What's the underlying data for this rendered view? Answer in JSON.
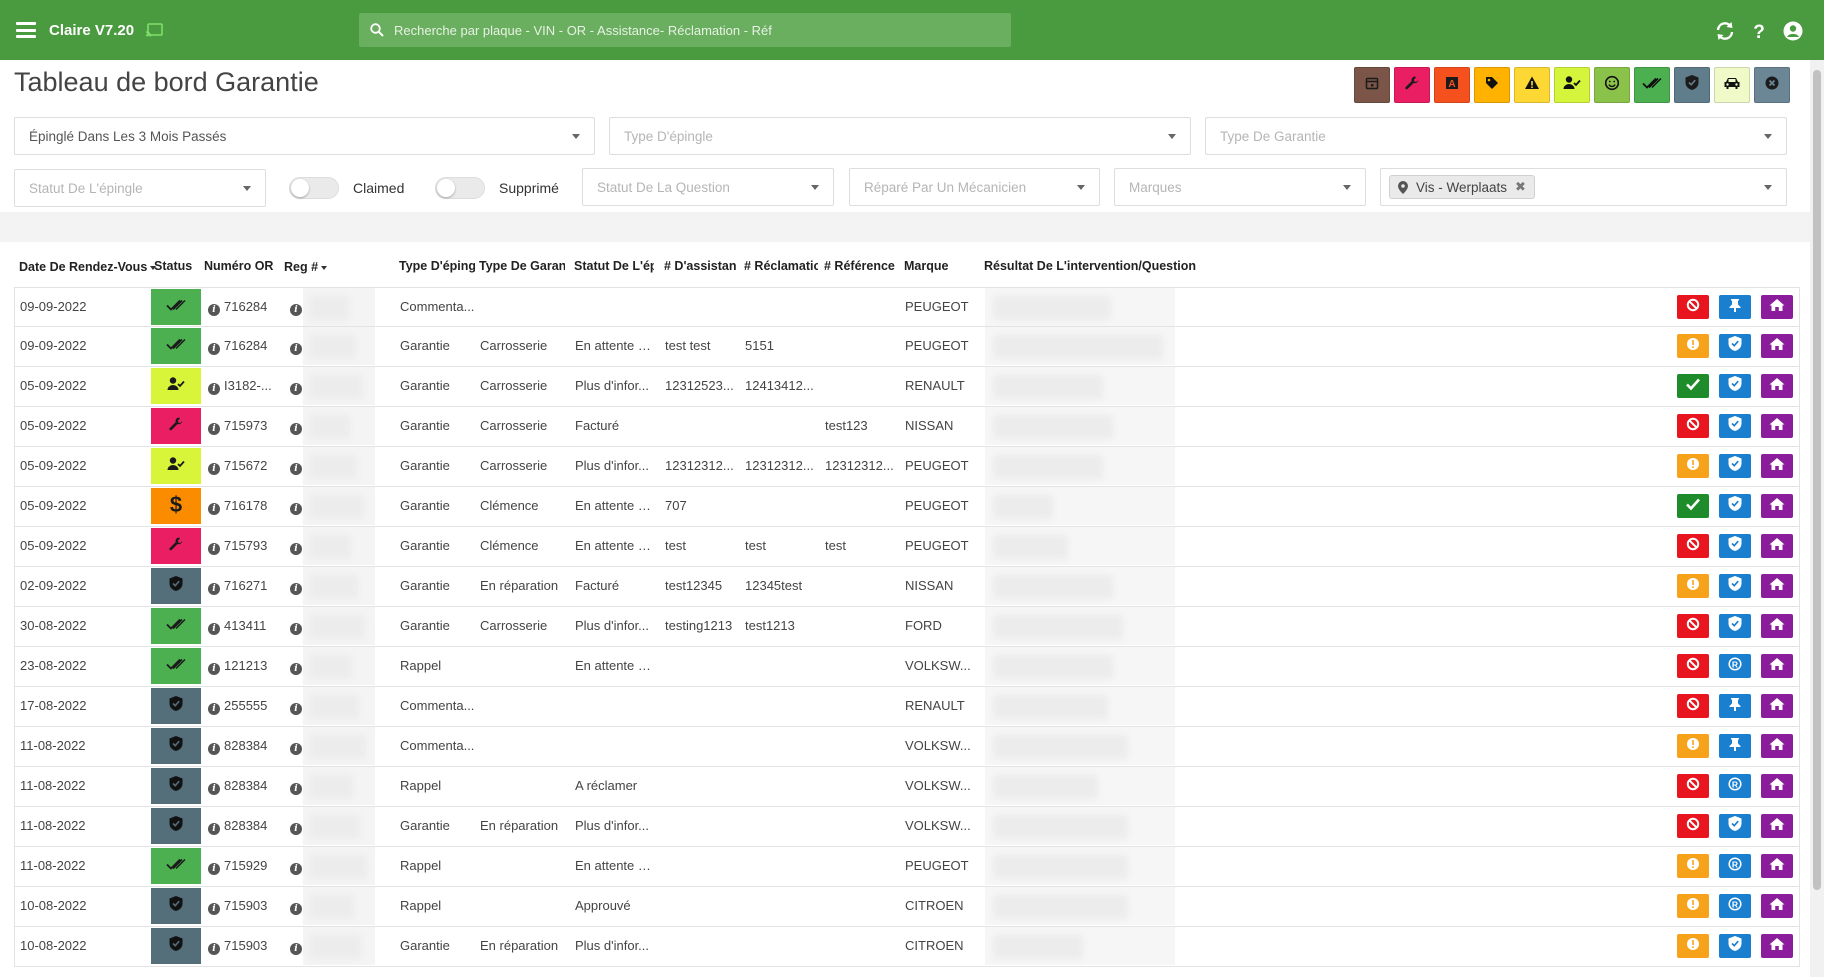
{
  "app": {
    "title": "Claire V7.20",
    "search_placeholder": "Recherche par plaque - VIN - OR - Assistance- Réclamation - Réf"
  },
  "page": {
    "title": "Tableau de bord Garantie"
  },
  "color_filters": [
    {
      "name": "calendar-icon",
      "color": "#7a5548"
    },
    {
      "name": "wrench-icon",
      "color": "#e91e63"
    },
    {
      "name": "font-icon",
      "color": "#f4511e"
    },
    {
      "name": "tag-icon",
      "color": "#ffb300"
    },
    {
      "name": "warning-icon",
      "color": "#fdd835"
    },
    {
      "name": "user-check-icon",
      "color": "#d4f53c"
    },
    {
      "name": "smile-icon",
      "color": "#8bc34a"
    },
    {
      "name": "double-check-icon",
      "color": "#4caf50"
    },
    {
      "name": "shield-icon",
      "color": "#607d8b"
    },
    {
      "name": "car-icon",
      "color": "#f0f9c8"
    },
    {
      "name": "close-circle-icon",
      "color": "#6b8795"
    }
  ],
  "filters": {
    "pinned_period": "Épinglé Dans Les 3 Mois Passés",
    "pin_type": "Type D'épingle",
    "warranty_type": "Type De Garantie",
    "pin_status": "Statut De L'épingle",
    "claimed_label": "Claimed",
    "deleted_label": "Supprimé",
    "question_status": "Statut De La Question",
    "repaired_by": "Réparé Par Un Mécanicien",
    "brands": "Marques",
    "location_chip": "Vis - Werplaats"
  },
  "table": {
    "headers": {
      "date": "Date De Rendez-Vous",
      "status": "Status",
      "or_number": "Numéro OR",
      "reg": "Reg #",
      "pin_type": "Type D'épingle",
      "warranty_type": "Type De Garantie",
      "pin_status": "Statut De L'épingle",
      "assistance": "# D'assistance",
      "claim": "# Réclamation",
      "reference": "# Référence",
      "brand": "Marque",
      "result": "Résultat De L'intervention/Question"
    },
    "rows": [
      {
        "date": "09-09-2022",
        "status": "double-check",
        "or": "716284",
        "pin_type": "Commenta...",
        "warranty": "",
        "pin_status": "",
        "assistance": "",
        "claim": "",
        "reference": "",
        "brand": "PEUGEOT",
        "flag": "red",
        "mid": "pin"
      },
      {
        "date": "09-09-2022",
        "status": "double-check",
        "or": "716284",
        "pin_type": "Garantie",
        "warranty": "Carrosserie",
        "pin_status": "En attente d'...",
        "assistance": "test test",
        "claim": "5151",
        "reference": "",
        "brand": "PEUGEOT",
        "flag": "orange",
        "mid": "shield"
      },
      {
        "date": "05-09-2022",
        "status": "user-check",
        "or": "I3182-...",
        "pin_type": "Garantie",
        "warranty": "Carrosserie",
        "pin_status": "Plus d'infor...",
        "assistance": "12312523...",
        "claim": "12413412...",
        "reference": "",
        "brand": "RENAULT",
        "flag": "green",
        "mid": "shield"
      },
      {
        "date": "05-09-2022",
        "status": "wrench",
        "or": "715973",
        "pin_type": "Garantie",
        "warranty": "Carrosserie",
        "pin_status": "Facturé",
        "assistance": "",
        "claim": "",
        "reference": "test123",
        "brand": "NISSAN",
        "flag": "red",
        "mid": "shield"
      },
      {
        "date": "05-09-2022",
        "status": "user-check",
        "or": "715672",
        "pin_type": "Garantie",
        "warranty": "Carrosserie",
        "pin_status": "Plus d'infor...",
        "assistance": "12312312...",
        "claim": "12312312...",
        "reference": "12312312...",
        "brand": "PEUGEOT",
        "flag": "orange",
        "mid": "shield"
      },
      {
        "date": "05-09-2022",
        "status": "dollar",
        "or": "716178",
        "pin_type": "Garantie",
        "warranty": "Clémence",
        "pin_status": "En attente d'...",
        "assistance": "707",
        "claim": "",
        "reference": "",
        "brand": "PEUGEOT",
        "flag": "green",
        "mid": "shield"
      },
      {
        "date": "05-09-2022",
        "status": "wrench",
        "or": "715793",
        "pin_type": "Garantie",
        "warranty": "Clémence",
        "pin_status": "En attente d'...",
        "assistance": "test",
        "claim": "test",
        "reference": "test",
        "brand": "PEUGEOT",
        "flag": "red",
        "mid": "shield"
      },
      {
        "date": "02-09-2022",
        "status": "shield",
        "or": "716271",
        "pin_type": "Garantie",
        "warranty": "En réparation",
        "pin_status": "Facturé",
        "assistance": "test12345",
        "claim": "12345test",
        "reference": "",
        "brand": "NISSAN",
        "flag": "orange",
        "mid": "shield"
      },
      {
        "date": "30-08-2022",
        "status": "double-check",
        "or": "413411",
        "pin_type": "Garantie",
        "warranty": "Carrosserie",
        "pin_status": "Plus d'infor...",
        "assistance": "testing1213",
        "claim": "test1213",
        "reference": "",
        "brand": "FORD",
        "flag": "red",
        "mid": "shield"
      },
      {
        "date": "23-08-2022",
        "status": "double-check",
        "or": "121213",
        "pin_type": "Rappel",
        "warranty": "",
        "pin_status": "En attente d'...",
        "assistance": "",
        "claim": "",
        "reference": "",
        "brand": "VOLKSW...",
        "flag": "red",
        "mid": "recall"
      },
      {
        "date": "17-08-2022",
        "status": "shield",
        "or": "255555",
        "pin_type": "Commenta...",
        "warranty": "",
        "pin_status": "",
        "assistance": "",
        "claim": "",
        "reference": "",
        "brand": "RENAULT",
        "flag": "red",
        "mid": "pin"
      },
      {
        "date": "11-08-2022",
        "status": "shield",
        "or": "828384",
        "pin_type": "Commenta...",
        "warranty": "",
        "pin_status": "",
        "assistance": "",
        "claim": "",
        "reference": "",
        "brand": "VOLKSW...",
        "flag": "orange",
        "mid": "pin"
      },
      {
        "date": "11-08-2022",
        "status": "shield",
        "or": "828384",
        "pin_type": "Rappel",
        "warranty": "",
        "pin_status": "A réclamer",
        "assistance": "",
        "claim": "",
        "reference": "",
        "brand": "VOLKSW...",
        "flag": "red",
        "mid": "recall"
      },
      {
        "date": "11-08-2022",
        "status": "shield",
        "or": "828384",
        "pin_type": "Garantie",
        "warranty": "En réparation",
        "pin_status": "Plus d'infor...",
        "assistance": "",
        "claim": "",
        "reference": "",
        "brand": "VOLKSW...",
        "flag": "red",
        "mid": "shield"
      },
      {
        "date": "11-08-2022",
        "status": "double-check",
        "or": "715929",
        "pin_type": "Rappel",
        "warranty": "",
        "pin_status": "En attente d'...",
        "assistance": "",
        "claim": "",
        "reference": "",
        "brand": "PEUGEOT",
        "flag": "orange",
        "mid": "recall"
      },
      {
        "date": "10-08-2022",
        "status": "shield",
        "or": "715903",
        "pin_type": "Rappel",
        "warranty": "",
        "pin_status": "Approuvé",
        "assistance": "",
        "claim": "",
        "reference": "",
        "brand": "CITROEN",
        "flag": "orange",
        "mid": "recall"
      },
      {
        "date": "10-08-2022",
        "status": "shield",
        "or": "715903",
        "pin_type": "Garantie",
        "warranty": "En réparation",
        "pin_status": "Plus d'infor...",
        "assistance": "",
        "claim": "",
        "reference": "",
        "brand": "CITROEN",
        "flag": "orange",
        "mid": "shield"
      }
    ]
  },
  "status_colors": {
    "double-check": "#4caf50",
    "user-check": "#d9f53a",
    "wrench": "#e91e63",
    "dollar": "#fb8c00",
    "shield": "#546e7a"
  }
}
